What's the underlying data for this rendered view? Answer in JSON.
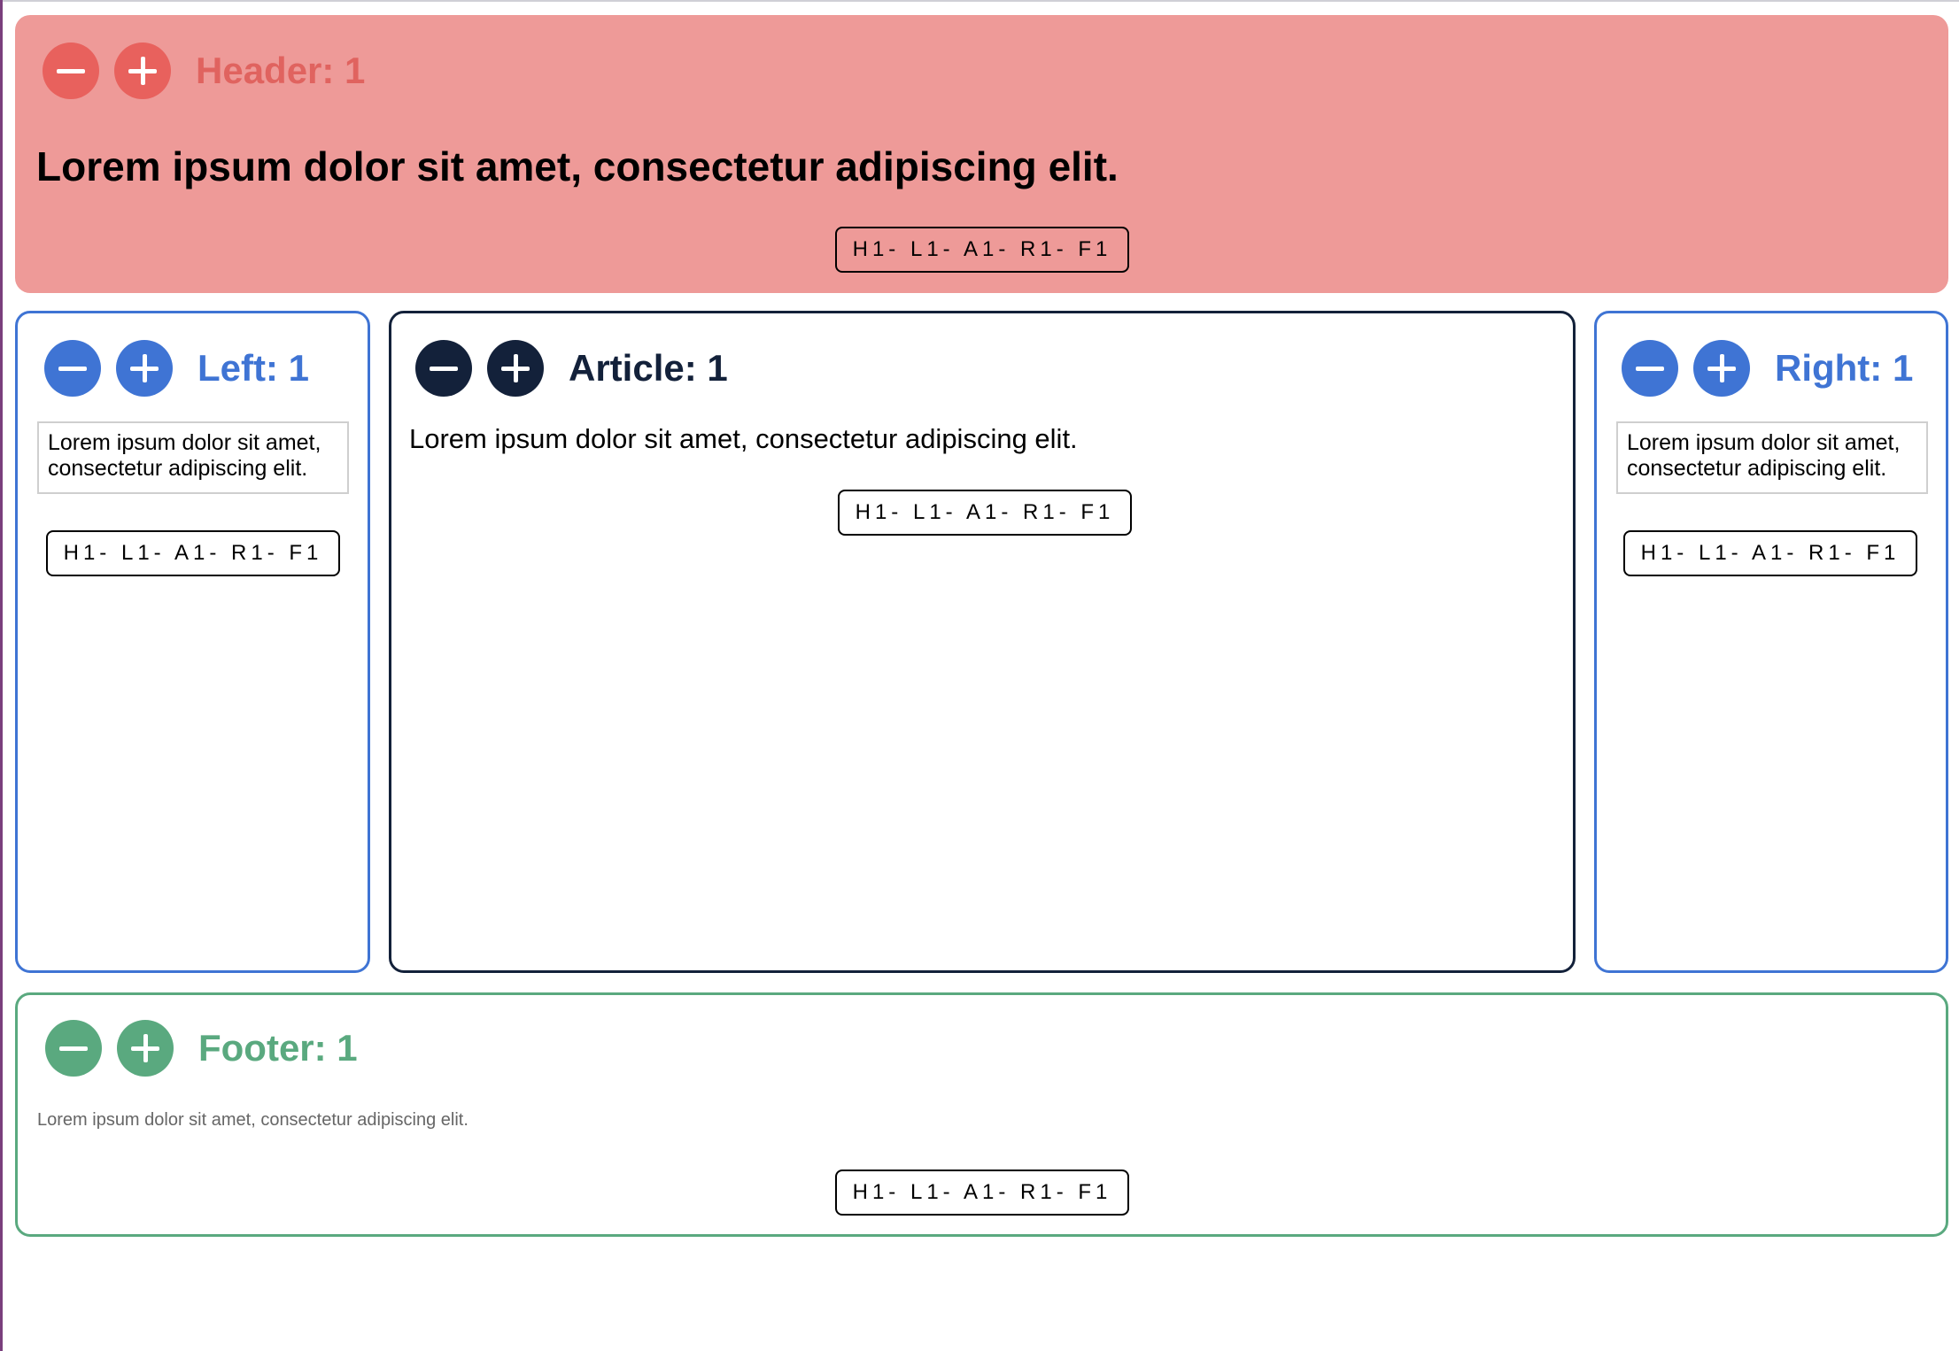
{
  "header": {
    "title": "Header: 1",
    "text": "Lorem ipsum dolor sit amet, consectetur adipiscing elit.",
    "tag": "H1- L1- A1- R1- F1",
    "color": "#ee9a98",
    "accent": "#e8615d"
  },
  "left": {
    "title": "Left: 1",
    "text": "Lorem ipsum dolor sit amet, consectetur adipiscing elit.",
    "tag": "H1- L1- A1- R1- F1",
    "accent": "#3f74d4"
  },
  "article": {
    "title": "Article: 1",
    "text": "Lorem ipsum dolor sit amet, consectetur adipiscing elit.",
    "tag": "H1- L1- A1- R1- F1",
    "accent": "#13213a"
  },
  "right": {
    "title": "Right: 1",
    "text": "Lorem ipsum dolor sit amet, consectetur adipiscing elit.",
    "tag": "H1- L1- A1- R1- F1",
    "accent": "#3f74d4"
  },
  "footer": {
    "title": "Footer: 1",
    "text": "Lorem ipsum dolor sit amet, consectetur adipiscing elit.",
    "tag": "H1- L1- A1- R1- F1",
    "accent": "#5aa97f"
  },
  "icons": {
    "decrement": "minus-icon",
    "increment": "plus-icon"
  }
}
